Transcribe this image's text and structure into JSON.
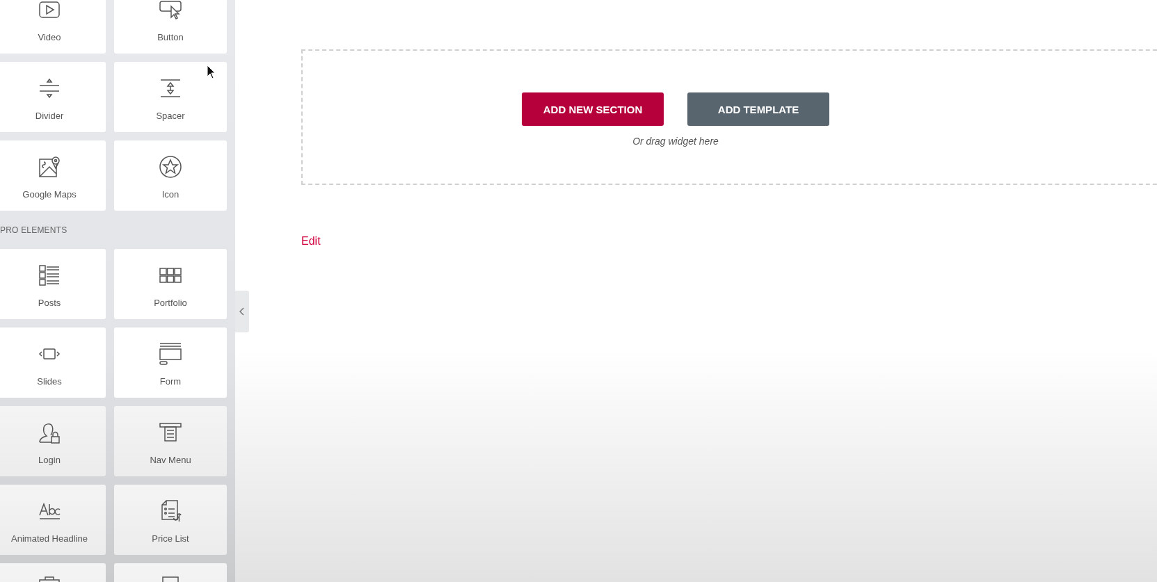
{
  "sidebar": {
    "widgets_top": [
      {
        "kind": "video",
        "label": "Video"
      },
      {
        "kind": "button",
        "label": "Button"
      },
      {
        "kind": "divider",
        "label": "Divider"
      },
      {
        "kind": "spacer",
        "label": "Spacer"
      },
      {
        "kind": "map",
        "label": "Google Maps"
      },
      {
        "kind": "star",
        "label": "Icon"
      }
    ],
    "section_title": "PRO ELEMENTS",
    "widgets_pro": [
      {
        "kind": "posts",
        "label": "Posts"
      },
      {
        "kind": "portfolio",
        "label": "Portfolio"
      },
      {
        "kind": "slides",
        "label": "Slides"
      },
      {
        "kind": "form",
        "label": "Form"
      },
      {
        "kind": "login",
        "label": "Login"
      },
      {
        "kind": "navmenu",
        "label": "Nav Menu"
      },
      {
        "kind": "headline",
        "label": "Animated Headline"
      },
      {
        "kind": "pricelist",
        "label": "Price List"
      },
      {
        "kind": "toolbox"
      },
      {
        "kind": "frame"
      }
    ]
  },
  "canvas": {
    "add_section_button": "ADD NEW SECTION",
    "add_template_button": "ADD TEMPLATE",
    "drop_hint": "Or drag widget here",
    "edit_link": "Edit"
  }
}
